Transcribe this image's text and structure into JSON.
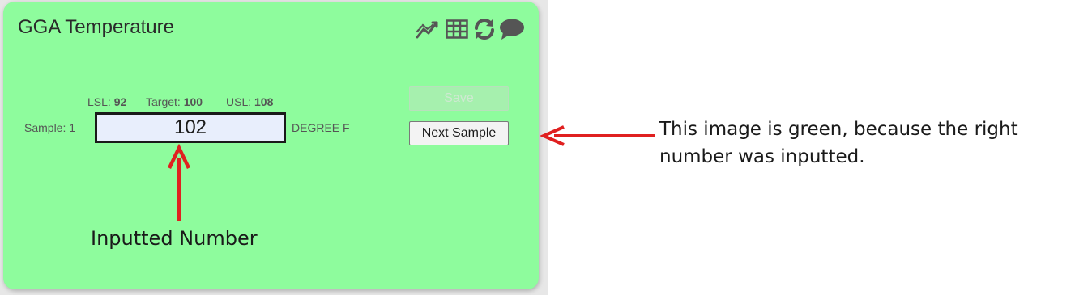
{
  "card": {
    "title": "GGA Temperature",
    "background_color": "#8efc9d",
    "toolbar": [
      {
        "icon": "trend-chart-icon"
      },
      {
        "icon": "table-icon"
      },
      {
        "icon": "refresh-icon"
      },
      {
        "icon": "comment-icon"
      }
    ]
  },
  "specs": {
    "lsl_label": "LSL:",
    "lsl_value": "92",
    "target_label": "Target:",
    "target_value": "100",
    "usl_label": "USL:",
    "usl_value": "108"
  },
  "sample": {
    "label": "Sample: 1",
    "value": "102",
    "unit": "DEGREE F"
  },
  "buttons": {
    "save_label": "Save",
    "next_label": "Next Sample"
  },
  "annotations": {
    "input_label": "Inputted Number",
    "note": "This image is green, because the right number was inputted.",
    "arrow_color": "#e02020"
  }
}
